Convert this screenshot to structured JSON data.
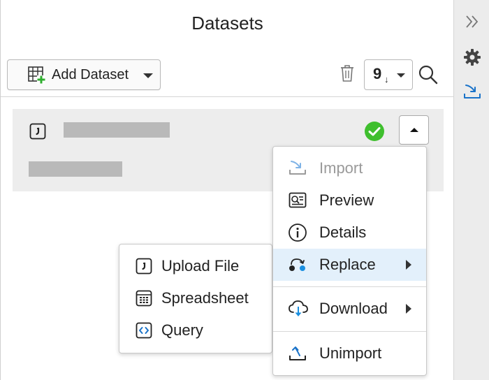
{
  "panel": {
    "title": "Datasets",
    "toolbar": {
      "add_dataset_label": "Add Dataset",
      "sort_value": "9",
      "sort_arrow": "↓"
    }
  },
  "context_menu": {
    "items": [
      {
        "label": "Import",
        "icon": "import-icon",
        "disabled": true
      },
      {
        "label": "Preview",
        "icon": "preview-icon"
      },
      {
        "label": "Details",
        "icon": "info-icon"
      },
      {
        "label": "Replace",
        "icon": "replace-icon",
        "has_submenu": true,
        "active": true
      },
      {
        "label": "Download",
        "icon": "download-cloud-icon",
        "has_submenu": true
      },
      {
        "label": "Unimport",
        "icon": "unimport-icon"
      }
    ]
  },
  "replace_submenu": {
    "items": [
      {
        "label": "Upload File",
        "icon": "file-icon"
      },
      {
        "label": "Spreadsheet",
        "icon": "spreadsheet-icon"
      },
      {
        "label": "Query",
        "icon": "query-icon"
      }
    ]
  },
  "colors": {
    "accent": "#1a73c9",
    "success": "#3fbf2e",
    "active_row": "#e3f0fb",
    "rail": "#ececec"
  }
}
